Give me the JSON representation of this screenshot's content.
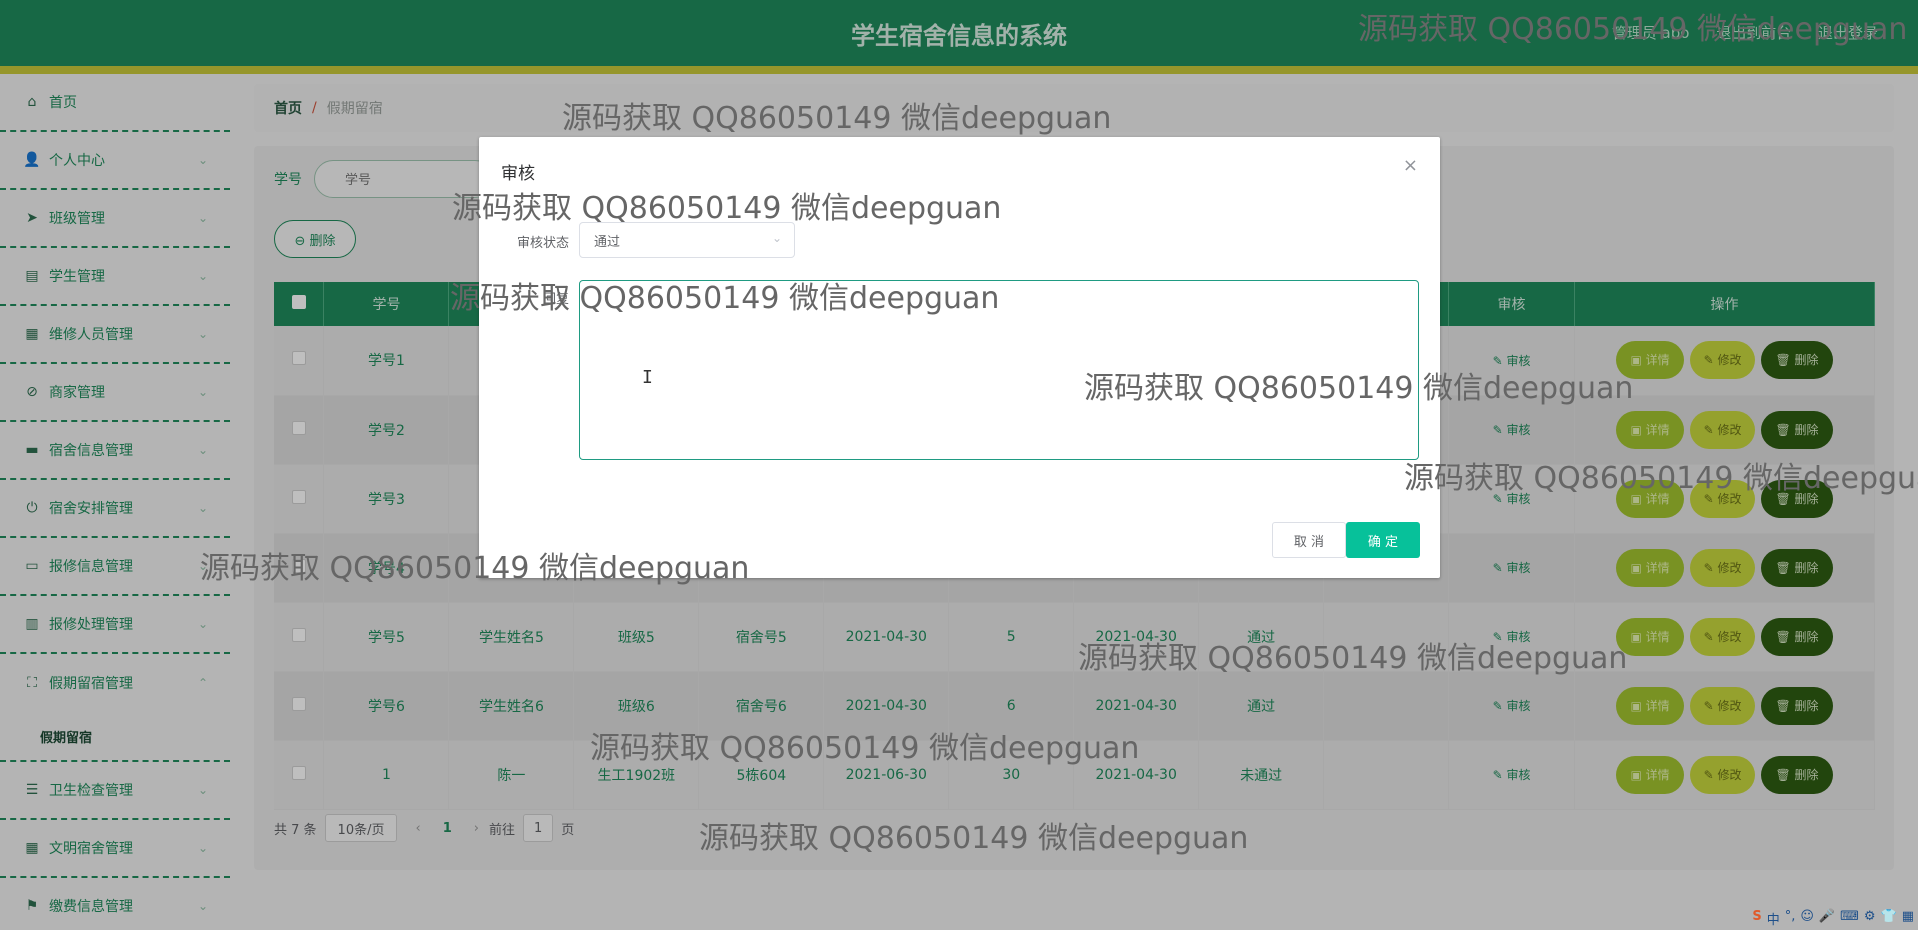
{
  "header": {
    "title": "学生宿舍信息的系统",
    "links": [
      "管理员 abo",
      "退出到前台",
      "退出登录"
    ]
  },
  "sidebar": {
    "items": [
      {
        "label": "首页",
        "icon": "home-icon",
        "glyph": "⌂",
        "chev": ""
      },
      {
        "label": "个人中心",
        "icon": "user-icon",
        "glyph": "👤",
        "chev": "⌄"
      },
      {
        "label": "班级管理",
        "icon": "send-icon",
        "glyph": "➤",
        "chev": "⌄"
      },
      {
        "label": "学生管理",
        "icon": "chart-icon",
        "glyph": "▤",
        "chev": "⌄"
      },
      {
        "label": "维修人员管理",
        "icon": "briefcase-icon",
        "glyph": "▦",
        "chev": "⌄"
      },
      {
        "label": "商家管理",
        "icon": "bell-off-icon",
        "glyph": "⊘",
        "chev": "⌄"
      },
      {
        "label": "宿舍信息管理",
        "icon": "inbox-icon",
        "glyph": "▬",
        "chev": "⌄"
      },
      {
        "label": "宿舍安排管理",
        "icon": "power-icon",
        "glyph": "⏻",
        "chev": "⌄"
      },
      {
        "label": "报修信息管理",
        "icon": "tv-icon",
        "glyph": "▭",
        "chev": "⌄"
      },
      {
        "label": "报修处理管理",
        "icon": "bar-chart-icon",
        "glyph": "▥",
        "chev": "⌄"
      },
      {
        "label": "假期留宿管理",
        "icon": "fullscreen-icon",
        "glyph": "⛶",
        "chev": "⌃"
      }
    ],
    "sub_item": "假期留宿",
    "items_after": [
      {
        "label": "卫生检查管理",
        "icon": "menu-icon",
        "glyph": "☰",
        "chev": "⌄"
      },
      {
        "label": "文明宿舍管理",
        "icon": "grid-icon",
        "glyph": "▦",
        "chev": "⌄"
      },
      {
        "label": "缴费信息管理",
        "icon": "flag-icon",
        "glyph": "⚑",
        "chev": "⌄"
      }
    ]
  },
  "breadcrumb": {
    "home": "首页",
    "sep": "/",
    "current": "假期留宿"
  },
  "search": {
    "label": "学号",
    "placeholder": "学号"
  },
  "toolbar": {
    "delete_label": "⊖ 删除"
  },
  "table": {
    "headers": [
      "学号",
      "",
      "",
      "",
      "",
      "",
      "",
      "",
      "审核",
      "操作"
    ],
    "rows": [
      {
        "c": [
          "学号1",
          "",
          "",
          "",
          "",
          "",
          "",
          "",
          "✎ 审核"
        ]
      },
      {
        "c": [
          "学号2",
          "",
          "",
          "",
          "",
          "",
          "",
          "",
          "✎ 审核"
        ]
      },
      {
        "c": [
          "学号3",
          "",
          "",
          "",
          "",
          "",
          "",
          "",
          "✎ 审核"
        ]
      },
      {
        "c": [
          "学号4",
          "",
          "",
          "",
          "",
          "",
          "",
          "",
          "✎ 审核"
        ]
      },
      {
        "c": [
          "学号5",
          "学生姓名5",
          "班级5",
          "宿舍号5",
          "2021-04-30",
          "5",
          "2021-04-30",
          "通过",
          "✎ 审核"
        ]
      },
      {
        "c": [
          "学号6",
          "学生姓名6",
          "班级6",
          "宿舍号6",
          "2021-04-30",
          "6",
          "2021-04-30",
          "通过",
          "✎ 审核"
        ]
      },
      {
        "c": [
          "1",
          "陈一",
          "生工1902班",
          "5栋604",
          "2021-06-30",
          "30",
          "2021-04-30",
          "未通过",
          "✎ 审核"
        ]
      }
    ],
    "actions": {
      "detail": "▣ 详情",
      "edit": "✎ 修改",
      "delete": "🗑 删除"
    }
  },
  "pager": {
    "total": "共 7 条",
    "page_size": "10条/页",
    "current": "1",
    "goto_prefix": "前往",
    "goto_value": "1",
    "goto_suffix": "页"
  },
  "dialog": {
    "title": "审核",
    "close": "×",
    "status_label": "审核状态",
    "status_value": "通过",
    "reply_label": "回复",
    "cancel": "取 消",
    "confirm": "确 定"
  },
  "watermark": "源码获取 QQ86050149 微信deepguan",
  "tray": [
    "S",
    "中",
    "°,",
    "☺",
    "🎤",
    "⌨",
    "⚙",
    "👕",
    "▦"
  ]
}
